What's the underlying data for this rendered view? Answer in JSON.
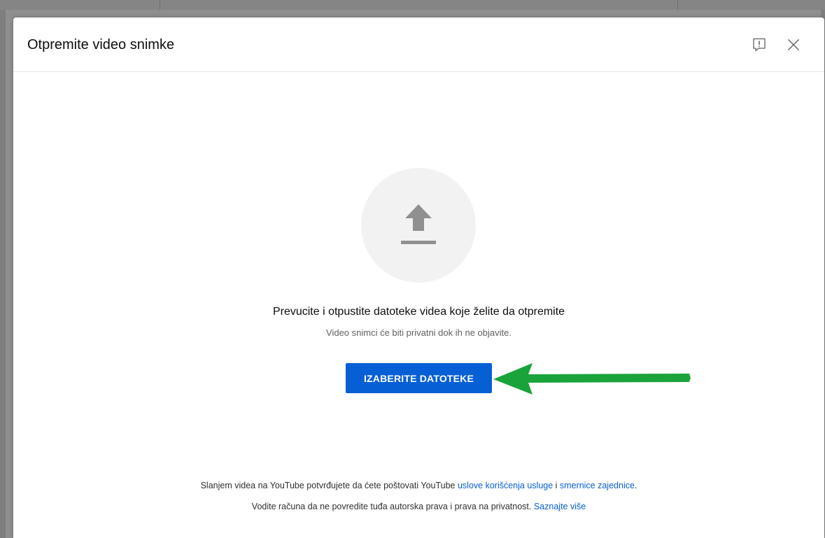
{
  "dialog": {
    "title": "Otpremite video snimke",
    "feedback_icon": "feedback-icon",
    "close_icon": "close-icon"
  },
  "upload": {
    "icon": "upload-arrow-icon",
    "primary_text": "Prevucite i otpustite datoteke videa koje želite da otpremite",
    "secondary_text": "Video snimci će biti privatni dok ih ne objavite.",
    "button_label": "IZABERITE DATOTEKE"
  },
  "footer": {
    "line1_prefix": "Slanjem videa na YouTube potvrđujete da ćete poštovati YouTube ",
    "terms_link": "uslove korišćenja usluge",
    "line1_middle": " i ",
    "guidelines_link": "smernice zajednice",
    "line1_suffix": ".",
    "line2_prefix": "Vodite računa da ne povredite tuđa autorska prava i prava na privatnost. ",
    "learn_more_link": "Saznajte više"
  },
  "colors": {
    "accent": "#065fd4",
    "annotation_arrow": "#1aa33a",
    "circle_bg": "#f2f2f2",
    "icon_gray": "#909090"
  }
}
